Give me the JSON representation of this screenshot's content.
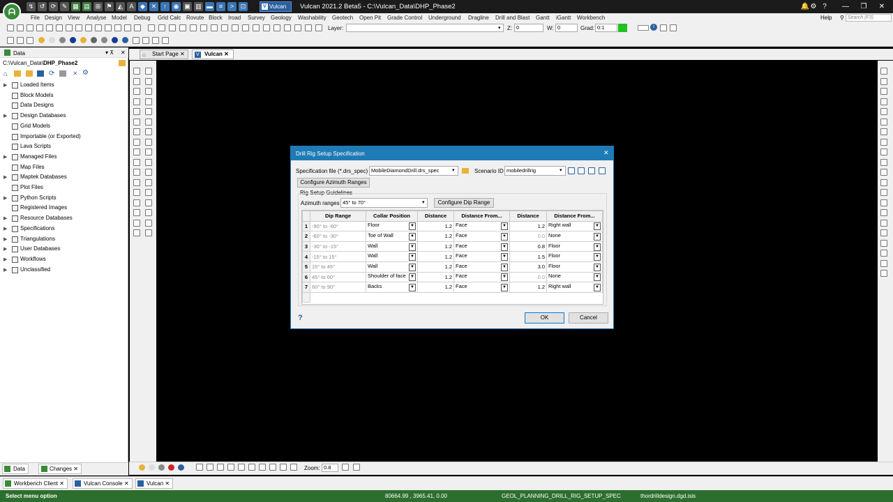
{
  "window": {
    "title": "Vulcan 2021.2 Beta5 - C:\\Vulcan_Data\\DHP_Phase2",
    "app_tab": "Vulcan"
  },
  "menu": [
    "File",
    "Design",
    "View",
    "Analyse",
    "Model",
    "Debug",
    "Grid Calc",
    "Rovute",
    "Block",
    "Iroad",
    "Survey",
    "Geology",
    "Washability",
    "Geotech",
    "Open Pit",
    "Grade Control",
    "Underground",
    "Dragline",
    "Drill and Blast",
    "Gantt",
    "iGantt",
    "Workbench"
  ],
  "help_menu": "Help",
  "search_placeholder": "Search (F3)",
  "toolbar": {
    "layer_label": "Layer:",
    "layer_value": "",
    "z_label": "Z:",
    "z_value": "0",
    "w_label": "W:",
    "w_value": "0",
    "grad_label": "Grad:",
    "grad_value": "0:1"
  },
  "left_panel": {
    "title": "Data",
    "path_prefix": "C:\\Vulcan_Data\\",
    "path_bold": "DHP_Phase2",
    "items": [
      {
        "label": "Loaded Items",
        "expandable": true
      },
      {
        "label": "Block Models",
        "expandable": false
      },
      {
        "label": "Data Designs",
        "expandable": false
      },
      {
        "label": "Design Databases",
        "expandable": true
      },
      {
        "label": "Grid Models",
        "expandable": false
      },
      {
        "label": "Importable (or Exported)",
        "expandable": false
      },
      {
        "label": "Lava Scripts",
        "expandable": false
      },
      {
        "label": "Managed Files",
        "expandable": true
      },
      {
        "label": "Map Files",
        "expandable": false
      },
      {
        "label": "Maptek Databases",
        "expandable": true
      },
      {
        "label": "Plot Files",
        "expandable": false
      },
      {
        "label": "Python Scripts",
        "expandable": true
      },
      {
        "label": "Registered Images",
        "expandable": false
      },
      {
        "label": "Resource Databases",
        "expandable": true
      },
      {
        "label": "Specifications",
        "expandable": true
      },
      {
        "label": "Triangulations",
        "expandable": true
      },
      {
        "label": "User Databases",
        "expandable": true
      },
      {
        "label": "Workflows",
        "expandable": true
      },
      {
        "label": "Unclassified",
        "expandable": true
      }
    ],
    "bottom_tabs": [
      "Data",
      "Changes"
    ]
  },
  "doc_tabs": [
    "Start Page",
    "Vulcan"
  ],
  "bottom_toolbar": {
    "zoom_label": "Zoom:",
    "zoom_value": "0.8"
  },
  "taskbar": [
    "Workbench Client",
    "Vulcan Console",
    "Vulcan"
  ],
  "status": {
    "left": "Select menu option",
    "coords": "80664.99 , 3965.41, 0.00",
    "command": "GEOL_PLANNING_DRILL_RIG_SETUP_SPEC",
    "file": "thordrilldesign.dgd.isis"
  },
  "dialog": {
    "title": "Drill Rig Setup Specification",
    "spec_label": "Specification file (*.drs_spec)",
    "spec_value": "MobileDiamondDrill.drs_spec",
    "scenario_label": "Scenario ID",
    "scenario_value": "mobiledrillrig",
    "configure_azimuth": "Configure Azimuth Ranges",
    "guidelines_label": "Rig Setup Guidelines",
    "azimuth_label": "Azimuth ranges",
    "azimuth_value": "45° to 70°",
    "configure_dip": "Configure Dip Range",
    "columns": [
      "Dip Range",
      "Collar Position",
      "Distance",
      "Distance From...",
      "Distance",
      "Distance From..."
    ],
    "rows": [
      {
        "n": "1",
        "dip": "-90° to -60°",
        "collar": "Floor",
        "d1": "1.2",
        "from1": "Face",
        "d2": "1.2",
        "from2": "Right wall",
        "d2_muted": false
      },
      {
        "n": "2",
        "dip": "-60° to -30°",
        "collar": "Toe of Wall",
        "d1": "1.2",
        "from1": "Face",
        "d2": "0.0",
        "from2": "None",
        "d2_muted": true
      },
      {
        "n": "3",
        "dip": "-30° to -15°",
        "collar": "Wall",
        "d1": "1.2",
        "from1": "Face",
        "d2": "0.8",
        "from2": "Floor",
        "d2_muted": false
      },
      {
        "n": "4",
        "dip": "-15° to 15°",
        "collar": "Wall",
        "d1": "1.2",
        "from1": "Face",
        "d2": "1.5",
        "from2": "Floor",
        "d2_muted": false
      },
      {
        "n": "5",
        "dip": "15° to 45°",
        "collar": "Wall",
        "d1": "1.2",
        "from1": "Face",
        "d2": "3.0",
        "from2": "Floor",
        "d2_muted": false
      },
      {
        "n": "6",
        "dip": "45° to 60°",
        "collar": "Shoulder of face",
        "d1": "1.2",
        "from1": "Face",
        "d2": "0.0",
        "from2": "None",
        "d2_muted": true
      },
      {
        "n": "7",
        "dip": "60° to 90°",
        "collar": "Backs",
        "d1": "1.2",
        "from1": "Face",
        "d2": "1.2",
        "from2": "Right wall",
        "d2_muted": false
      }
    ],
    "ok": "OK",
    "cancel": "Cancel"
  }
}
